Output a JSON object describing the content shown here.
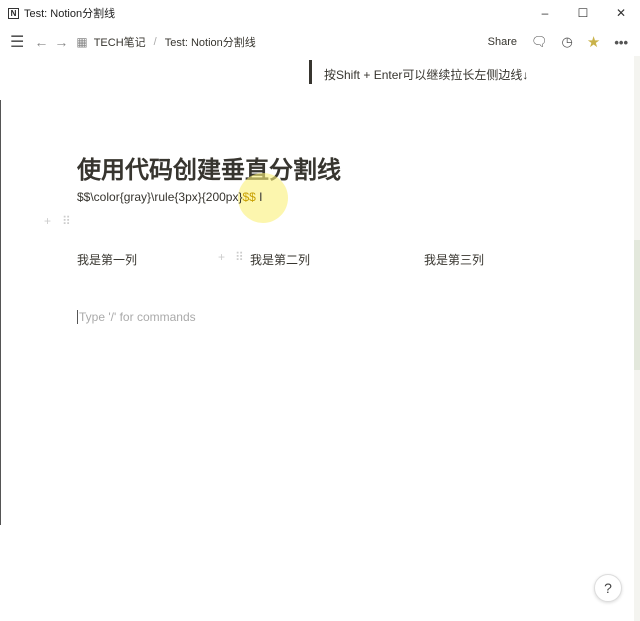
{
  "window": {
    "title": "Test: Notion分割线",
    "app_icon": "N",
    "minimize": "–",
    "maximize": "☐",
    "close": "✕"
  },
  "topbar": {
    "breadcrumbs": [
      "TECH笔记",
      "Test: Notion分割线"
    ],
    "separator": "/",
    "share": "Share"
  },
  "page": {
    "quote": "按Shift + Enter可以继续拉长左侧边线↓",
    "title": "使用代码创建垂直分割线",
    "code_main": "$$\\color{gray}\\rule{3px}{200px}",
    "code_end": "$$",
    "columns": [
      "我是第一列",
      "我是第二列",
      "我是第三列"
    ],
    "placeholder": "Type '/' for commands"
  },
  "help": "?"
}
